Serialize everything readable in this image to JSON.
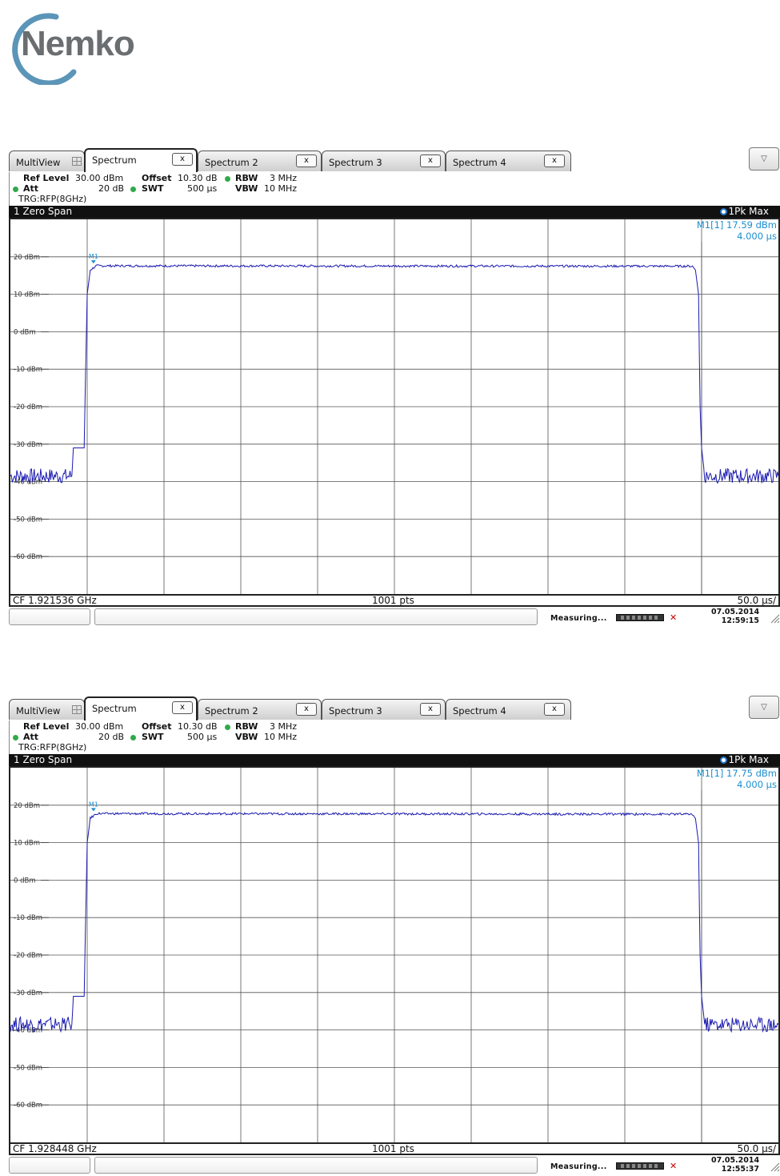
{
  "logo": {
    "text": "Nemko",
    "ring_color": "#5b95b8",
    "text_color": "#6b6e70"
  },
  "panels": [
    {
      "tabs": [
        {
          "label": "MultiView",
          "icon": "grid-icon"
        },
        {
          "label": "Spectrum",
          "close": "x",
          "active": true
        },
        {
          "label": "Spectrum 2",
          "close": "x"
        },
        {
          "label": "Spectrum 3",
          "close": "x"
        },
        {
          "label": "Spectrum 4",
          "close": "x"
        }
      ],
      "dropdown_icon": "chevron-down-icon",
      "settings": {
        "ref_level_label": "Ref Level",
        "ref_level_value": "30.00 dBm",
        "offset_label": "Offset",
        "offset_value": "10.30 dB",
        "rbw_label": "RBW",
        "rbw_value": "3 MHz",
        "att_label": "Att",
        "att_value": "20 dB",
        "swt_label": "SWT",
        "swt_value": "500 µs",
        "vbw_label": "VBW",
        "vbw_value": "10 MHz",
        "trigger": "TRG:RFP(8GHz)"
      },
      "window_title": "1 Zero Span",
      "trace_label": "1Pk Max",
      "marker_readout": {
        "name": "M1[1]",
        "level": "17.59 dBm",
        "time": "4.000 µs",
        "label": "M1"
      },
      "footer": {
        "cf": "CF 1.921536 GHz",
        "pts": "1001 pts",
        "span": "50.0 µs/"
      },
      "status": {
        "text": "Measuring...",
        "date": "07.05.2014",
        "time": "12:59:15"
      }
    },
    {
      "tabs": [
        {
          "label": "MultiView",
          "icon": "grid-icon"
        },
        {
          "label": "Spectrum",
          "close": "x",
          "active": true
        },
        {
          "label": "Spectrum 2",
          "close": "x"
        },
        {
          "label": "Spectrum 3",
          "close": "x"
        },
        {
          "label": "Spectrum 4",
          "close": "x"
        }
      ],
      "dropdown_icon": "chevron-down-icon",
      "settings": {
        "ref_level_label": "Ref Level",
        "ref_level_value": "30.00 dBm",
        "offset_label": "Offset",
        "offset_value": "10.30 dB",
        "rbw_label": "RBW",
        "rbw_value": "3 MHz",
        "att_label": "Att",
        "att_value": "20 dB",
        "swt_label": "SWT",
        "swt_value": "500 µs",
        "vbw_label": "VBW",
        "vbw_value": "10 MHz",
        "trigger": "TRG:RFP(8GHz)"
      },
      "window_title": "1 Zero Span",
      "trace_label": "1Pk Max",
      "marker_readout": {
        "name": "M1[1]",
        "level": "17.75 dBm",
        "time": "4.000 µs",
        "label": "M1"
      },
      "footer": {
        "cf": "CF 1.928448 GHz",
        "pts": "1001 pts",
        "span": "50.0 µs/"
      },
      "status": {
        "text": "Measuring...",
        "date": "07.05.2014",
        "time": "12:55:37"
      }
    }
  ],
  "chart_data": [
    {
      "type": "line",
      "x_unit": "µs",
      "x_per_division": 50,
      "x_range": [
        0,
        500
      ],
      "y_ticks": [
        "20 dBm",
        "10 dBm",
        "0 dBm",
        "-10 dBm",
        "-20 dBm",
        "-30 dBm",
        "-40 dBm",
        "-50 dBm",
        "-60 dBm"
      ],
      "ylim": [
        -70,
        30
      ],
      "grid": true,
      "trace_color": "#1a1ab0",
      "marker_color": "#1b8fd0",
      "series": [
        {
          "x": [
            0,
            40,
            41,
            48,
            50,
            52,
            56,
            444,
            446,
            448,
            449,
            450,
            452,
            500
          ],
          "y": [
            -38.5,
            -38.5,
            -31,
            -31,
            10,
            16.5,
            17.59,
            17.5,
            16.5,
            10,
            -20,
            -31,
            -38.5,
            -38.5
          ]
        }
      ],
      "marker": {
        "x": 4,
        "y": 17.59
      },
      "marker_line_x": 450
    },
    {
      "type": "line",
      "x_unit": "µs",
      "x_per_division": 50,
      "x_range": [
        0,
        500
      ],
      "y_ticks": [
        "20 dBm",
        "10 dBm",
        "0 dBm",
        "-10 dBm",
        "-20 dBm",
        "-30 dBm",
        "-40 dBm",
        "-50 dBm",
        "-60 dBm"
      ],
      "ylim": [
        -70,
        30
      ],
      "grid": true,
      "trace_color": "#1a1ab0",
      "marker_color": "#1b8fd0",
      "series": [
        {
          "x": [
            0,
            40,
            41,
            48,
            50,
            52,
            56,
            444,
            446,
            448,
            449,
            450,
            452,
            500
          ],
          "y": [
            -38.5,
            -38.5,
            -31,
            -31,
            10,
            16.5,
            17.75,
            17.6,
            16.5,
            10,
            -20,
            -31,
            -38.5,
            -38.5
          ]
        }
      ],
      "marker": {
        "x": 4,
        "y": 17.75
      },
      "marker_line_x": 450
    }
  ]
}
